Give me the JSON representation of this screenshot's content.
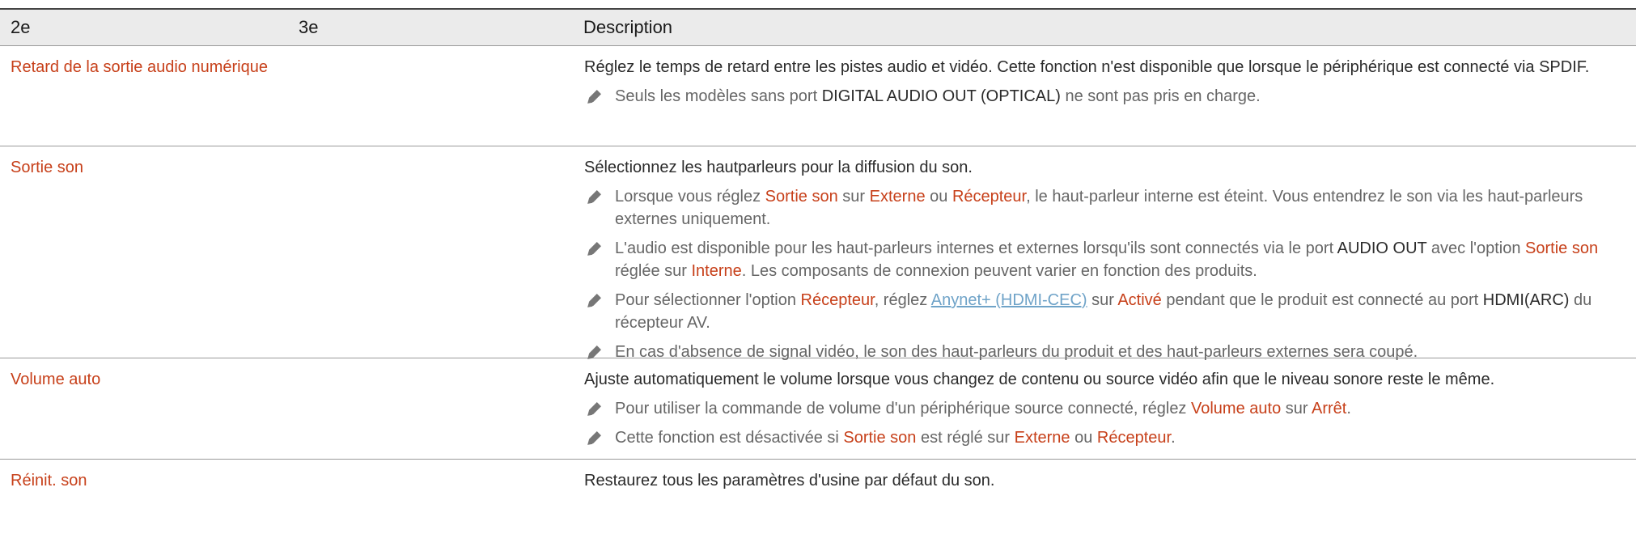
{
  "header": {
    "col1": "2e",
    "col2": "3e",
    "col3": "Description"
  },
  "rows": [
    {
      "setting": "Retard de la sortie audio numérique",
      "description": "Réglez le temps de retard entre les pistes audio et vidéo. Cette fonction n'est disponible que lorsque le périphérique est connecté via SPDIF.",
      "notes": [
        {
          "t1": "Seuls les modèles sans port ",
          "b1": "DIGITAL AUDIO OUT (OPTICAL)",
          "t2": " ne sont pas pris en charge."
        }
      ]
    },
    {
      "setting": "Sortie son",
      "description": "Sélectionnez les hautparleurs pour la diffusion du son.",
      "notes": [
        {
          "t1": "Lorsque vous réglez ",
          "h1": "Sortie son",
          "t2": " sur ",
          "h2": "Externe",
          "t3": " ou ",
          "h3": "Récepteur",
          "t4": ", le haut-parleur interne est éteint. Vous entendrez le son via les haut-parleurs externes uniquement."
        },
        {
          "t1": "L'audio est disponible pour les haut-parleurs internes et externes lorsqu'ils sont connectés via le port ",
          "b1": "AUDIO OUT",
          "t2": " avec l'option ",
          "h1": "Sortie son",
          "t3": " réglée sur ",
          "h2": "Interne",
          "t4": ". Les composants de connexion peuvent varier en fonction des produits."
        },
        {
          "t1": "Pour sélectionner l'option ",
          "h1": "Récepteur",
          "t2": ", réglez ",
          "link": "Anynet+ (HDMI-CEC)",
          "t3": " sur ",
          "h2": "Activé",
          "t4": " pendant que le produit est connecté au port ",
          "b1": "HDMI(ARC)",
          "t5": " du récepteur AV."
        },
        {
          "t1": "En cas d'absence de signal vidéo, le son des haut-parleurs du produit et des haut-parleurs externes sera coupé."
        }
      ]
    },
    {
      "setting": "Volume auto",
      "description": "Ajuste automatiquement le volume lorsque vous changez de contenu ou source vidéo afin que le niveau sonore reste le même.",
      "notes": [
        {
          "t1": "Pour utiliser la commande de volume d'un périphérique source connecté, réglez ",
          "h1": "Volume auto",
          "t2": " sur ",
          "h2": "Arrêt",
          "t3": "."
        },
        {
          "t1": "Cette fonction est désactivée si ",
          "h1": "Sortie son",
          "t2": " est réglé sur ",
          "h2": "Externe",
          "t3": " ou ",
          "h3": "Récepteur",
          "t4": "."
        }
      ]
    },
    {
      "setting": "Réinit. son",
      "description": "Restaurez tous les paramètres d'usine par défaut du son."
    }
  ],
  "icons": {
    "note": "pencil-note-icon"
  },
  "colors": {
    "highlight": "#c7401a",
    "link": "#6fa3c8",
    "header_bg": "#ebebeb"
  }
}
